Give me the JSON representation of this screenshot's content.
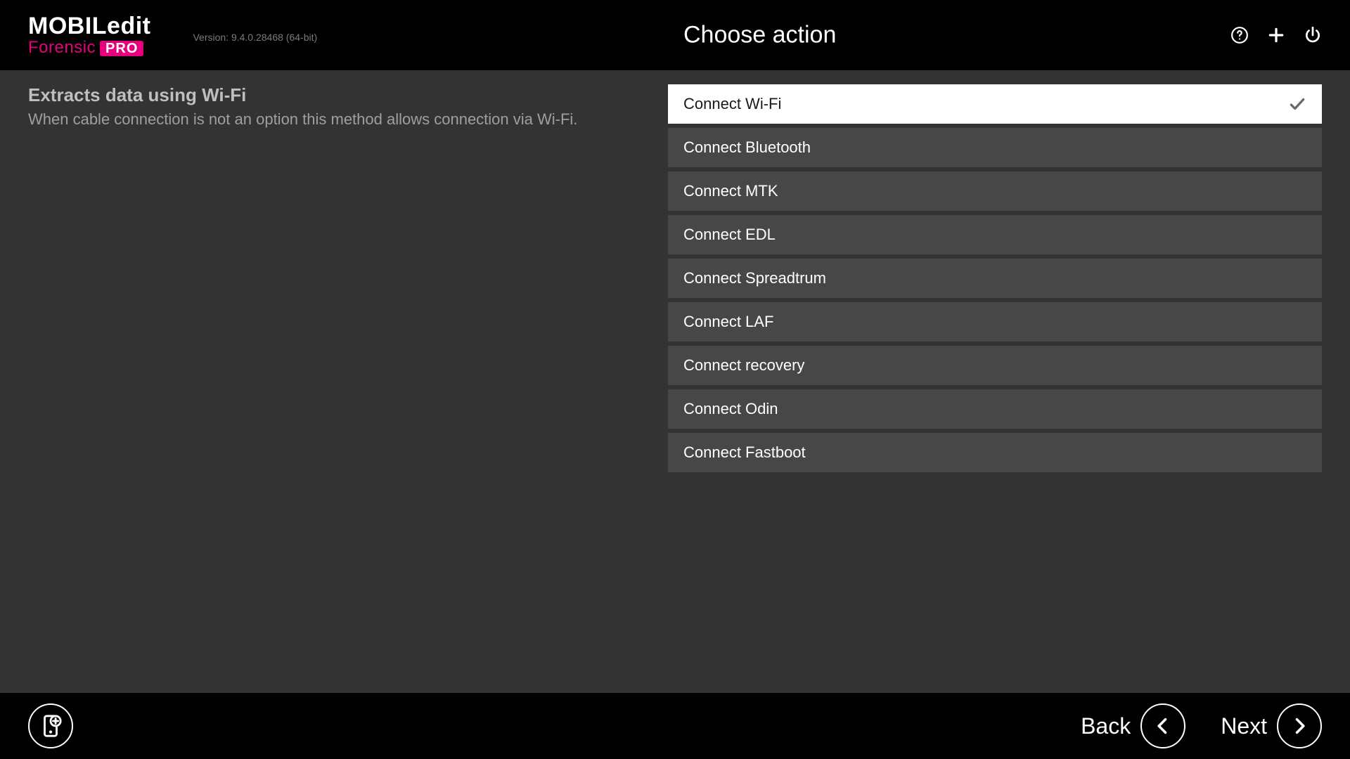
{
  "header": {
    "logo_line1": "MOBILedit",
    "logo_forensic": "Forensic",
    "logo_pro": "PRO",
    "version": "Version: 9.4.0.28468 (64-bit)",
    "title": "Choose action"
  },
  "description": {
    "title": "Extracts data using Wi-Fi",
    "text": "When cable connection is not an option this method allows connection via Wi-Fi."
  },
  "actions": [
    {
      "label": "Connect Wi-Fi",
      "selected": true
    },
    {
      "label": "Connect Bluetooth",
      "selected": false
    },
    {
      "label": "Connect MTK",
      "selected": false
    },
    {
      "label": "Connect EDL",
      "selected": false
    },
    {
      "label": "Connect Spreadtrum",
      "selected": false
    },
    {
      "label": "Connect LAF",
      "selected": false
    },
    {
      "label": "Connect recovery",
      "selected": false
    },
    {
      "label": "Connect Odin",
      "selected": false
    },
    {
      "label": "Connect Fastboot",
      "selected": false
    }
  ],
  "footer": {
    "back_label": "Back",
    "next_label": "Next"
  }
}
